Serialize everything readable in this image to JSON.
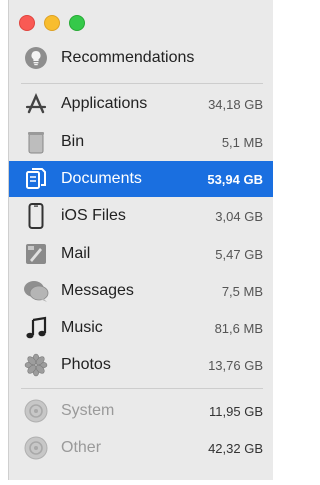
{
  "sidebar": {
    "recommendations": "Recommendations",
    "items": [
      {
        "label": "Applications",
        "size": "34,18 GB"
      },
      {
        "label": "Bin",
        "size": "5,1 MB"
      },
      {
        "label": "Documents",
        "size": "53,94 GB"
      },
      {
        "label": "iOS Files",
        "size": "3,04 GB"
      },
      {
        "label": "Mail",
        "size": "5,47 GB"
      },
      {
        "label": "Messages",
        "size": "7,5 MB"
      },
      {
        "label": "Music",
        "size": "81,6 MB"
      },
      {
        "label": "Photos",
        "size": "13,76 GB"
      }
    ],
    "other_items": [
      {
        "label": "System",
        "size": "11,95 GB"
      },
      {
        "label": "Other",
        "size": "42,32 GB"
      }
    ]
  },
  "colors": {
    "selection": "#1a6fe0",
    "close": "#f95a54",
    "minimize": "#f8bd2e",
    "zoom": "#35c94a"
  }
}
